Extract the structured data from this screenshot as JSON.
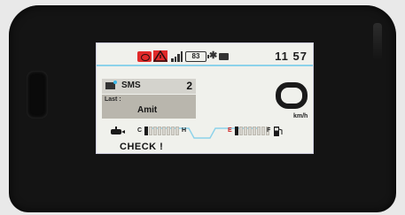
{
  "status_bar": {
    "battery_level": "83",
    "bluetooth_symbol": "✱",
    "time": "11 57",
    "icons": [
      "engine-warning-icon",
      "warning-triangle-icon",
      "signal-strength-icon",
      "battery-icon",
      "bluetooth-icon",
      "mail-icon"
    ]
  },
  "sms": {
    "label": "SMS",
    "count": "2",
    "last_label": "Last :",
    "last_name": "Amit"
  },
  "speed": {
    "unit": "km/h",
    "value": "0"
  },
  "temperature_gauge": {
    "low_label": "C",
    "high_label": "H",
    "level_fraction": 0.1
  },
  "fuel_gauge": {
    "empty_label": "E",
    "full_label": "F",
    "level_fraction": 0.1
  },
  "message": {
    "text": "CHECK !"
  },
  "colors": {
    "accent_blue": "#8cd2ea",
    "warning_red": "#e02a2a",
    "screen_bg": "#f0f1ec"
  }
}
